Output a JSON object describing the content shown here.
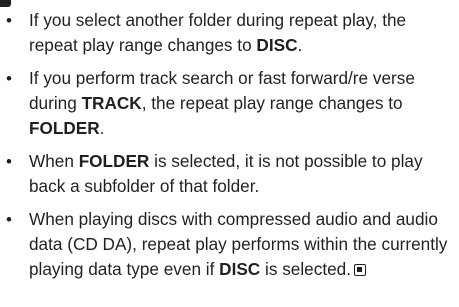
{
  "notes": [
    {
      "text": [
        {
          "t": "If you select another folder during repeat play, the repeat play range changes to ",
          "b": false
        },
        {
          "t": "DISC",
          "b": true
        },
        {
          "t": ".",
          "b": false
        }
      ]
    },
    {
      "text": [
        {
          "t": "If you perform track search or fast forward/re verse during ",
          "b": false
        },
        {
          "t": "TRACK",
          "b": true
        },
        {
          "t": ", the repeat play range changes to ",
          "b": false
        },
        {
          "t": "FOLDER",
          "b": true
        },
        {
          "t": ".",
          "b": false
        }
      ]
    },
    {
      "text": [
        {
          "t": "When ",
          "b": false
        },
        {
          "t": "FOLDER",
          "b": true
        },
        {
          "t": " is selected, it is not possible to play back a subfolder of that folder.",
          "b": false
        }
      ]
    },
    {
      "text": [
        {
          "t": "When playing discs with compressed audio and audio data (CD DA), repeat play performs within the currently playing data type even if ",
          "b": false
        },
        {
          "t": "DISC",
          "b": true
        },
        {
          "t": " is selected.",
          "b": false
        }
      ],
      "end_mark": true
    }
  ],
  "bullet_symbol": "•"
}
